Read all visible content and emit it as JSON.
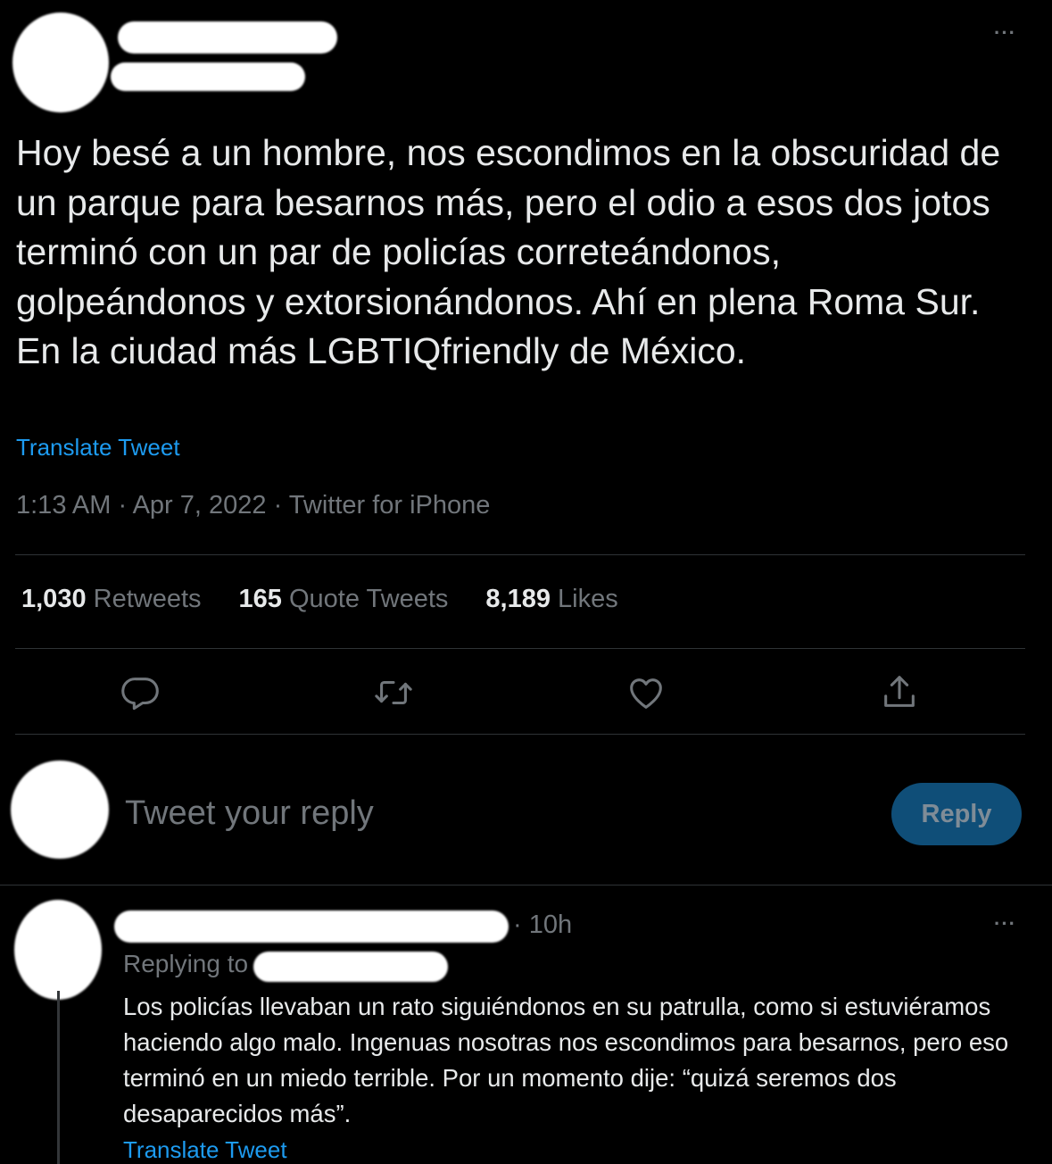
{
  "tweet": {
    "text": "Hoy besé a un hombre, nos escondimos en la obscuridad de un parque para besarnos más, pero el odio a esos dos jotos terminó con un par de policías correteándonos, golpeándonos y extorsionándonos. Ahí en plena Roma Sur. En la ciudad más LGBTIQfriendly de México.",
    "translate_label": "Translate Tweet",
    "meta": "1:13 AM · Apr 7, 2022 · Twitter for iPhone",
    "more_icon": "···",
    "stats": {
      "retweets_count": "1,030",
      "retweets_label": "Retweets",
      "quotes_count": "165",
      "quotes_label": "Quote Tweets",
      "likes_count": "8,189",
      "likes_label": "Likes"
    },
    "actions": [
      "reply-icon",
      "retweet-icon",
      "like-icon",
      "share-icon"
    ]
  },
  "composer": {
    "placeholder": "Tweet your reply",
    "reply_button": "Reply"
  },
  "reply": {
    "time": "· 10h",
    "replying_to": "Replying to",
    "text": "Los policías llevaban un rato siguiéndonos en su patrulla, como si estuviéramos haciendo algo malo. Ingenuas nosotras nos escondimos para besarnos, pero eso terminó en un miedo terrible. Por un momento dije: “quizá seremos dos desaparecidos más”.",
    "translate_label": "Translate Tweet",
    "more_icon": "···"
  },
  "colors": {
    "background": "#000000",
    "text": "#e7e9ea",
    "muted": "#71767b",
    "accent": "#1d9bf0",
    "reply_button_bg": "#0f4e78"
  }
}
